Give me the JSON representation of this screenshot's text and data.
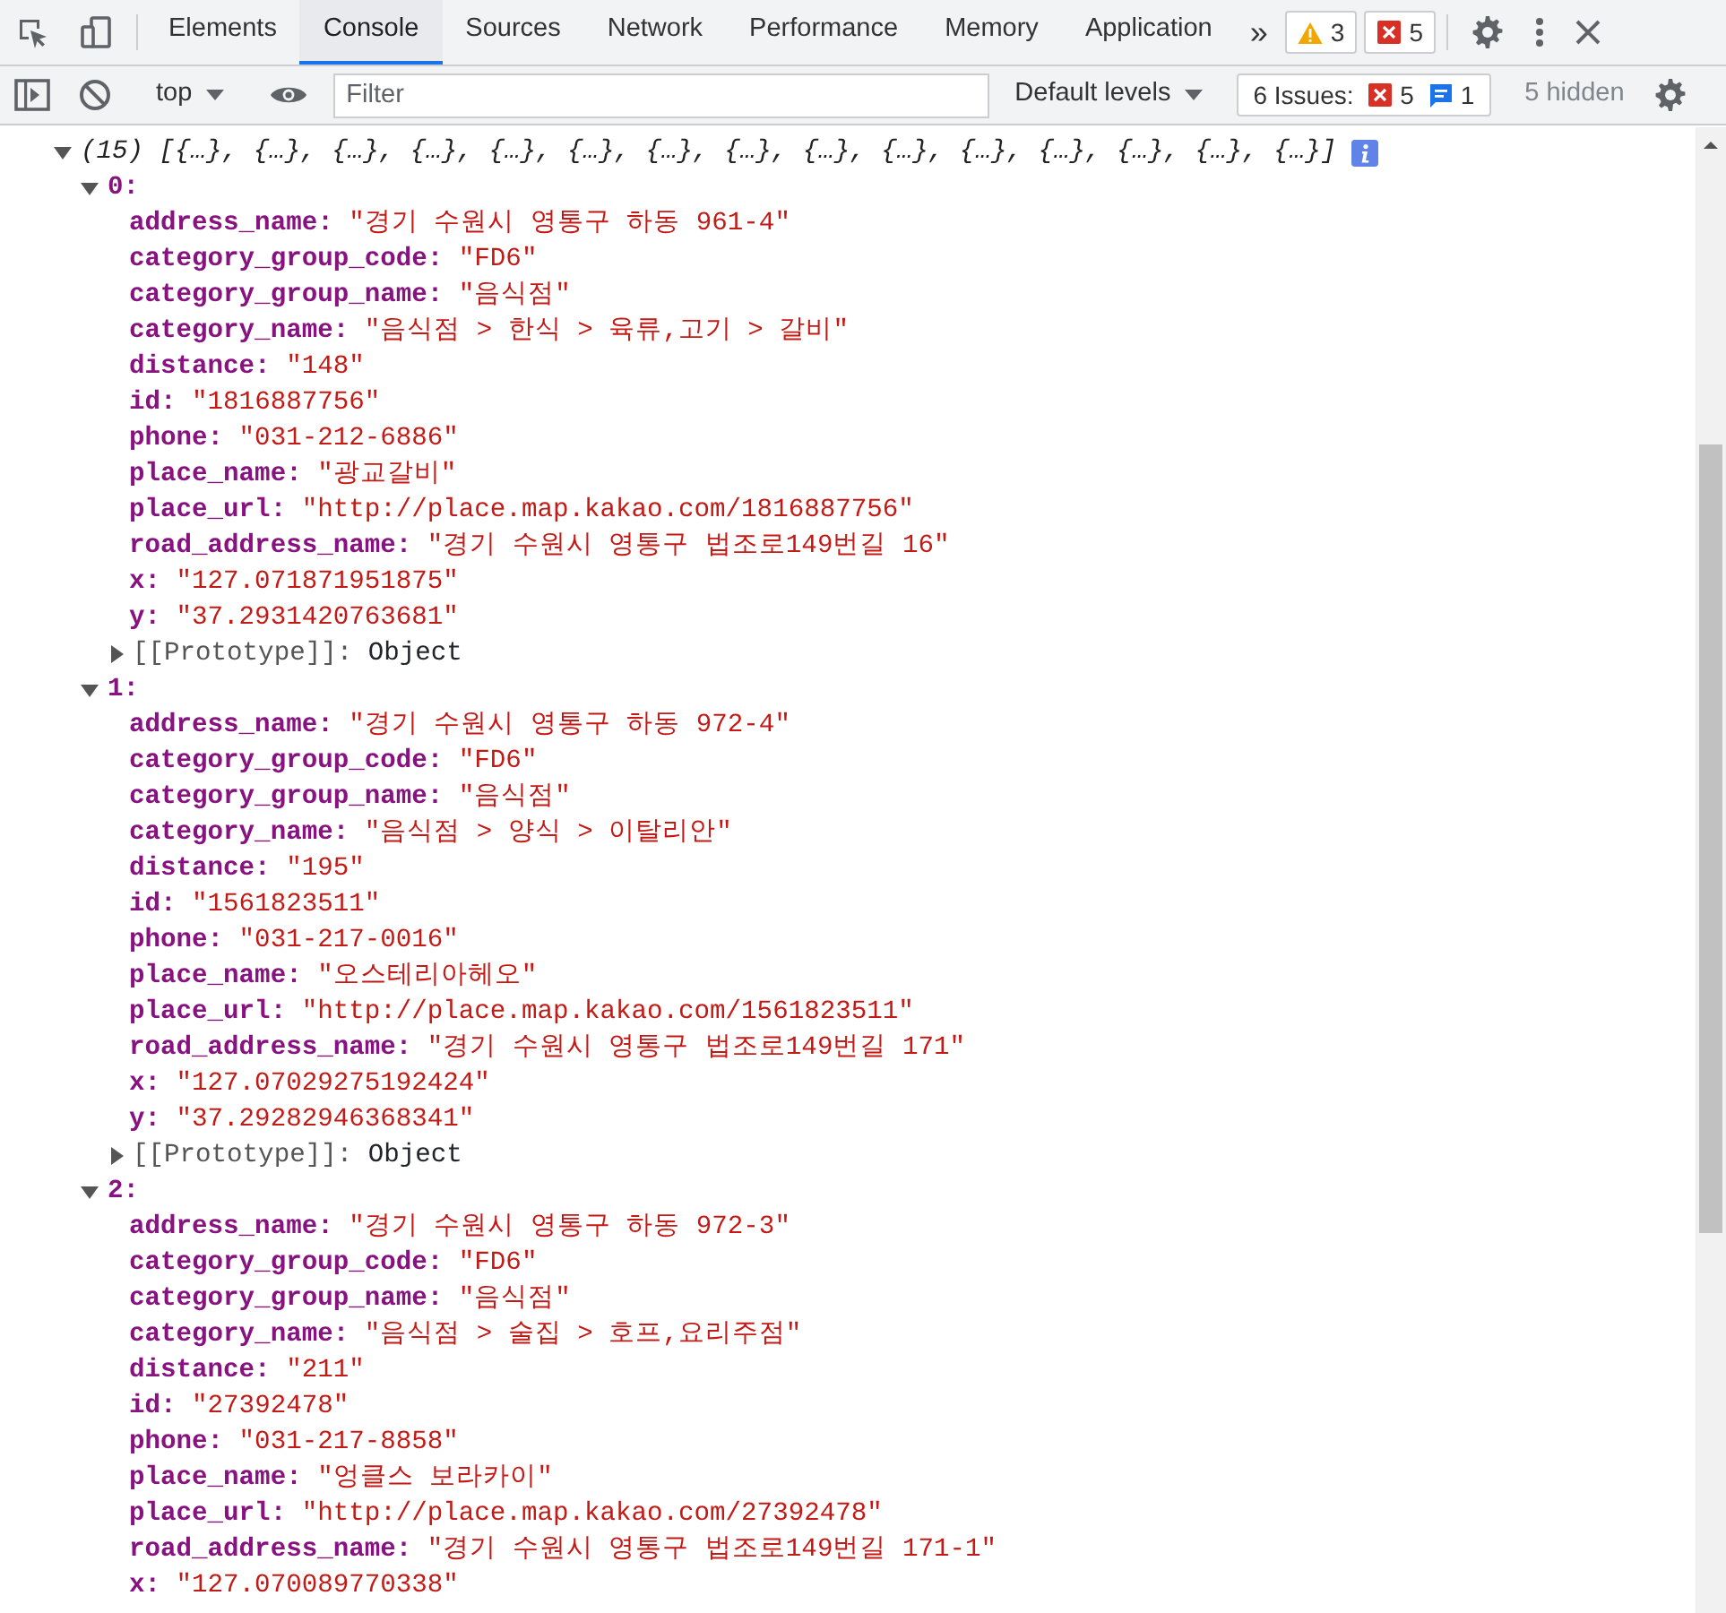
{
  "tabbar": {
    "tabs": [
      {
        "label": "Elements",
        "selected": false
      },
      {
        "label": "Console",
        "selected": true
      },
      {
        "label": "Sources",
        "selected": false
      },
      {
        "label": "Network",
        "selected": false
      },
      {
        "label": "Performance",
        "selected": false
      },
      {
        "label": "Memory",
        "selected": false
      },
      {
        "label": "Application",
        "selected": false
      }
    ],
    "more": "»",
    "warnings": "3",
    "errors": "5"
  },
  "console_toolbar": {
    "context": "top",
    "filter_placeholder": "Filter",
    "levels": "Default levels",
    "issues_label": "6 Issues:",
    "issues_errors": "5",
    "issues_info": "1",
    "hidden": "5 hidden"
  },
  "console": {
    "length": "(15)",
    "preview": "[{…}, {…}, {…}, {…}, {…}, {…}, {…}, {…}, {…}, {…}, {…}, {…}, {…}, {…}, {…}]",
    "expanded": true,
    "items": [
      {
        "index": "0:",
        "expanded": true,
        "properties": [
          {
            "key": "address_name:",
            "value": "\"경기 수원시 영통구 하동 961-4\""
          },
          {
            "key": "category_group_code:",
            "value": "\"FD6\""
          },
          {
            "key": "category_group_name:",
            "value": "\"음식점\""
          },
          {
            "key": "category_name:",
            "value": "\"음식점 > 한식 > 육류,고기 > 갈비\""
          },
          {
            "key": "distance:",
            "value": "\"148\""
          },
          {
            "key": "id:",
            "value": "\"1816887756\""
          },
          {
            "key": "phone:",
            "value": "\"031-212-6886\""
          },
          {
            "key": "place_name:",
            "value": "\"광교갈비\""
          },
          {
            "key": "place_url:",
            "value": "\"http://place.map.kakao.com/1816887756\""
          },
          {
            "key": "road_address_name:",
            "value": "\"경기 수원시 영통구 법조로149번길 16\""
          },
          {
            "key": "x:",
            "value": "\"127.071871951875\""
          },
          {
            "key": "y:",
            "value": "\"37.2931420763681\""
          }
        ],
        "prototype": {
          "key": "[[Prototype]]:",
          "value": "Object",
          "expanded": false
        }
      },
      {
        "index": "1:",
        "expanded": true,
        "properties": [
          {
            "key": "address_name:",
            "value": "\"경기 수원시 영통구 하동 972-4\""
          },
          {
            "key": "category_group_code:",
            "value": "\"FD6\""
          },
          {
            "key": "category_group_name:",
            "value": "\"음식점\""
          },
          {
            "key": "category_name:",
            "value": "\"음식점 > 양식 > 이탈리안\""
          },
          {
            "key": "distance:",
            "value": "\"195\""
          },
          {
            "key": "id:",
            "value": "\"1561823511\""
          },
          {
            "key": "phone:",
            "value": "\"031-217-0016\""
          },
          {
            "key": "place_name:",
            "value": "\"오스테리아헤오\""
          },
          {
            "key": "place_url:",
            "value": "\"http://place.map.kakao.com/1561823511\""
          },
          {
            "key": "road_address_name:",
            "value": "\"경기 수원시 영통구 법조로149번길 171\""
          },
          {
            "key": "x:",
            "value": "\"127.07029275192424\""
          },
          {
            "key": "y:",
            "value": "\"37.29282946368341\""
          }
        ],
        "prototype": {
          "key": "[[Prototype]]:",
          "value": "Object",
          "expanded": false
        }
      },
      {
        "index": "2:",
        "expanded": true,
        "properties": [
          {
            "key": "address_name:",
            "value": "\"경기 수원시 영통구 하동 972-3\""
          },
          {
            "key": "category_group_code:",
            "value": "\"FD6\""
          },
          {
            "key": "category_group_name:",
            "value": "\"음식점\""
          },
          {
            "key": "category_name:",
            "value": "\"음식점 > 술집 > 호프,요리주점\""
          },
          {
            "key": "distance:",
            "value": "\"211\""
          },
          {
            "key": "id:",
            "value": "\"27392478\""
          },
          {
            "key": "phone:",
            "value": "\"031-217-8858\""
          },
          {
            "key": "place_name:",
            "value": "\"엉클스 보라카이\""
          },
          {
            "key": "place_url:",
            "value": "\"http://place.map.kakao.com/27392478\""
          },
          {
            "key": "road_address_name:",
            "value": "\"경기 수원시 영통구 법조로149번길 171-1\""
          },
          {
            "key": "x:",
            "value": "\"127.070089770338\""
          }
        ]
      }
    ]
  }
}
